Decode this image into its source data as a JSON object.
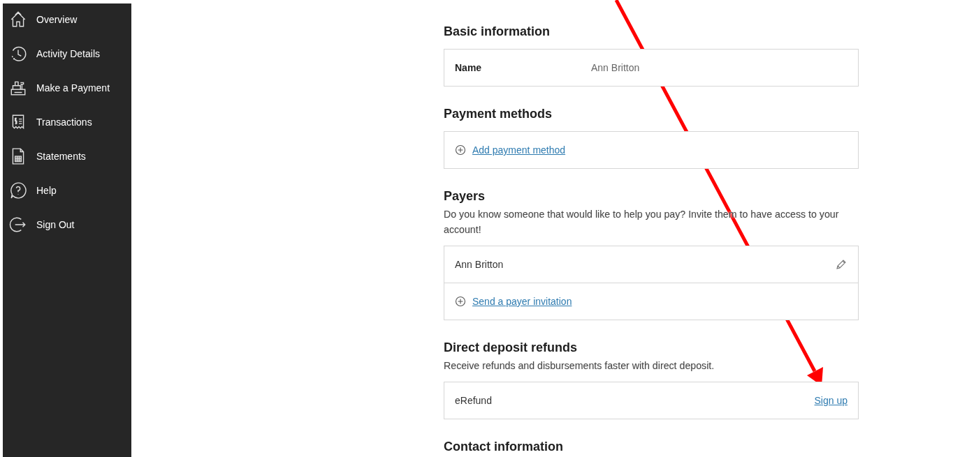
{
  "sidebar": {
    "items": [
      {
        "label": "Overview"
      },
      {
        "label": "Activity Details"
      },
      {
        "label": "Make a Payment"
      },
      {
        "label": "Transactions"
      },
      {
        "label": "Statements"
      },
      {
        "label": "Help"
      },
      {
        "label": "Sign Out"
      }
    ]
  },
  "sections": [
    {
      "title": "Basic information",
      "rows": [
        {
          "kind": "field",
          "label": "Name",
          "value": "Ann Britton"
        }
      ]
    },
    {
      "title": "Payment methods",
      "rows": [
        {
          "kind": "add",
          "link": "Add payment method"
        }
      ]
    },
    {
      "title": "Payers",
      "description": "Do you know someone that would like to help you pay? Invite them to have access to your account!",
      "rows": [
        {
          "kind": "editable",
          "text": "Ann Britton"
        },
        {
          "kind": "add",
          "link": "Send a payer invitation"
        }
      ]
    },
    {
      "title": "Direct deposit refunds",
      "description": "Receive refunds and disbursements faster with direct deposit.",
      "rows": [
        {
          "kind": "action",
          "text": "eRefund",
          "link": "Sign up"
        }
      ]
    },
    {
      "title": "Contact information"
    }
  ]
}
